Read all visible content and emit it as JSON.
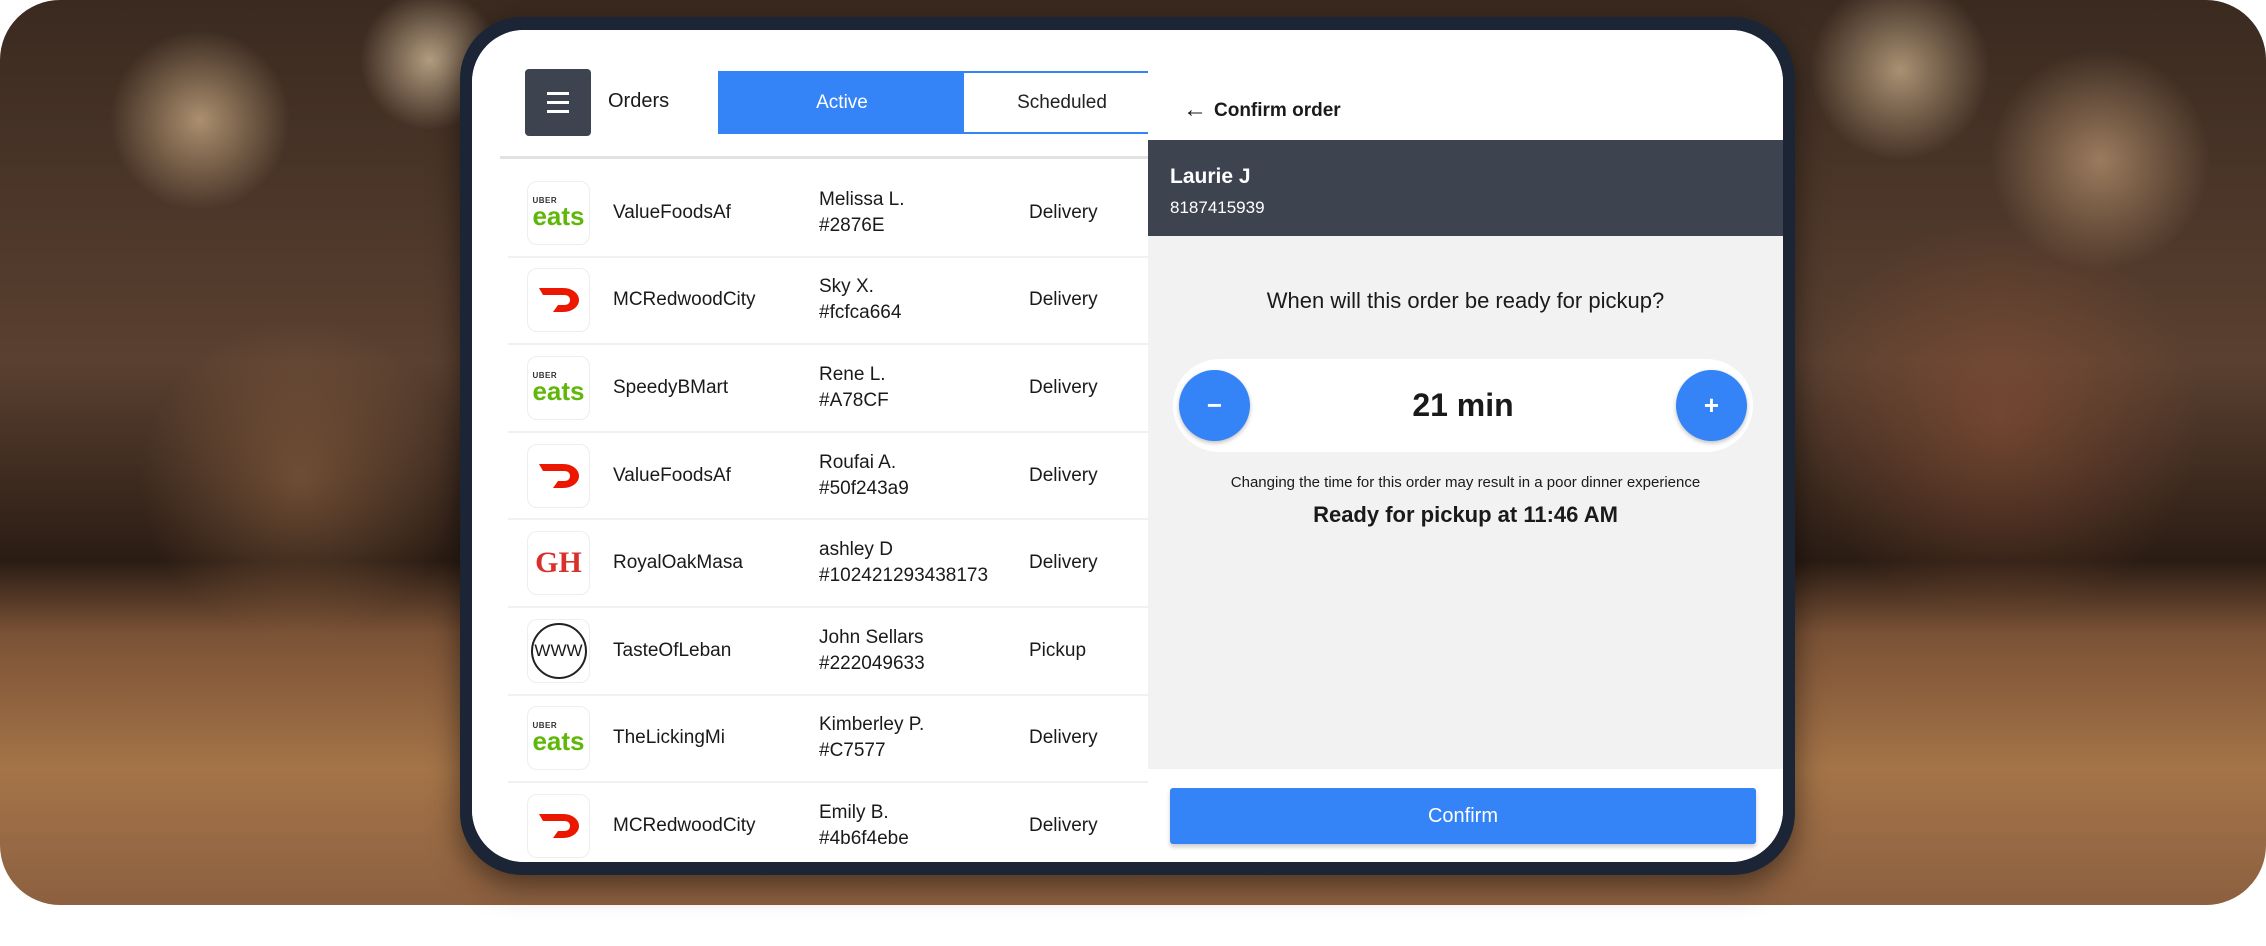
{
  "header": {
    "menu_icon": "hamburger-icon",
    "title": "Orders"
  },
  "tabs": [
    {
      "label": "Active",
      "active": true
    },
    {
      "label": "Scheduled",
      "active": false
    }
  ],
  "orders": [
    {
      "platform": "uber-eats",
      "restaurant": "ValueFoodsAf",
      "customer": "Melissa L.",
      "order_id": "#2876E",
      "type": "Delivery"
    },
    {
      "platform": "doordash",
      "restaurant": "MCRedwoodCity",
      "customer": "Sky X.",
      "order_id": "#fcfca664",
      "type": "Delivery"
    },
    {
      "platform": "uber-eats",
      "restaurant": "SpeedyBMart",
      "customer": "Rene L.",
      "order_id": "#A78CF",
      "type": "Delivery"
    },
    {
      "platform": "doordash",
      "restaurant": "ValueFoodsAf",
      "customer": "Roufai A.",
      "order_id": "#50f243a9",
      "type": "Delivery"
    },
    {
      "platform": "grubhub",
      "restaurant": "RoyalOakMasa",
      "customer": "ashley D",
      "order_id": "#102421293438173",
      "type": "Delivery"
    },
    {
      "platform": "web",
      "restaurant": "TasteOfLeban",
      "customer": "John Sellars",
      "order_id": "#222049633",
      "type": "Pickup"
    },
    {
      "platform": "uber-eats",
      "restaurant": "TheLickingMi",
      "customer": "Kimberley P.",
      "order_id": "#C7577",
      "type": "Delivery"
    },
    {
      "platform": "doordash",
      "restaurant": "MCRedwoodCity",
      "customer": "Emily B.",
      "order_id": "#4b6f4ebe",
      "type": "Delivery"
    }
  ],
  "logos": {
    "uber_small": "UBER",
    "uber_big": "eats",
    "grubhub": "GH",
    "web": "WWW"
  },
  "confirm": {
    "title": "Confirm order",
    "customer_name": "Laurie J",
    "customer_phone": "8187415939",
    "question": "When will this order be ready for pickup?",
    "minus": "−",
    "plus": "+",
    "time_value": "21 min",
    "warning": "Changing the time for this order may result in a poor dinner experience",
    "ready_text": "Ready for pickup at 11:46 AM",
    "confirm_label": "Confirm"
  },
  "colors": {
    "accent": "#3483f7",
    "dark": "#3d4450",
    "uber_green": "#5fb709",
    "doordash_red": "#eb1700",
    "grubhub_red": "#d9302c"
  }
}
